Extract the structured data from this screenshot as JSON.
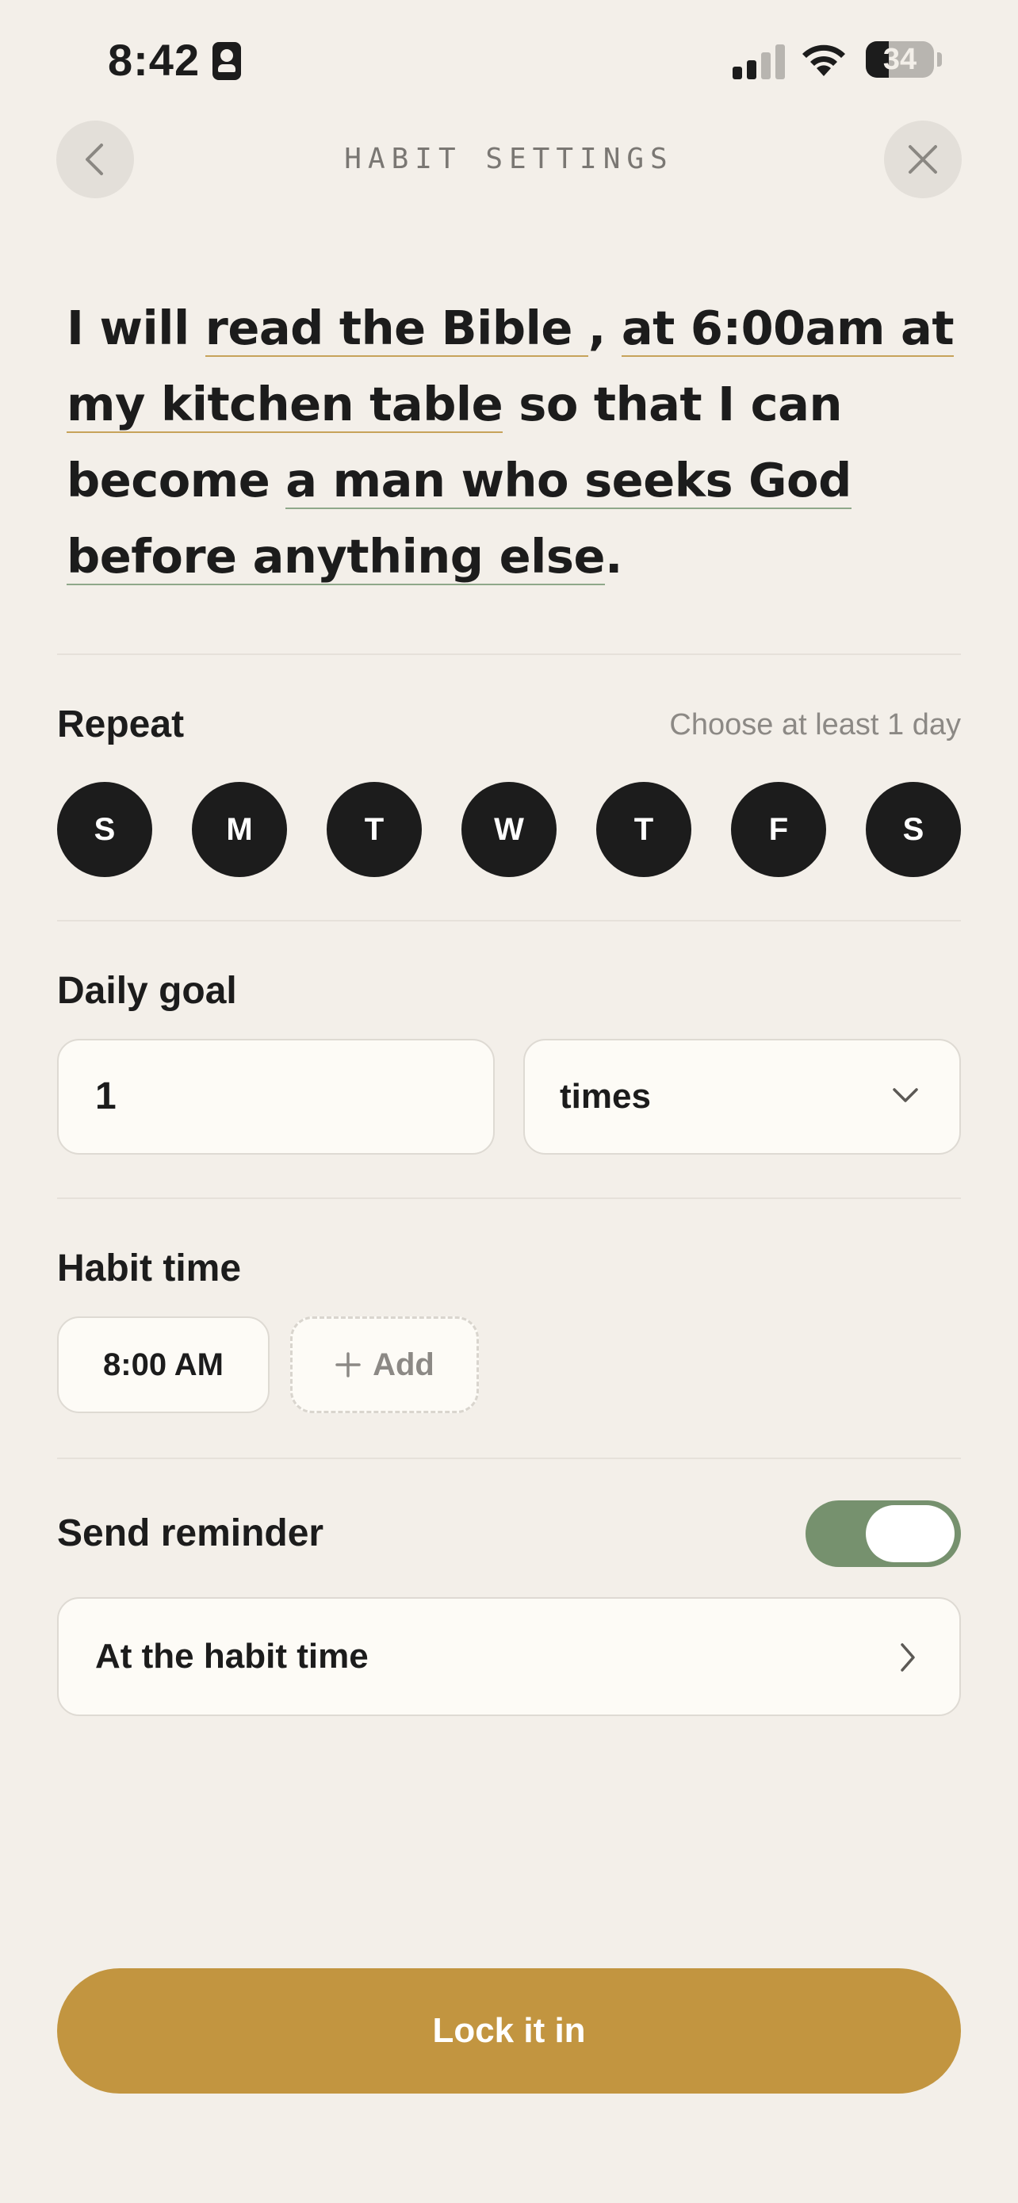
{
  "status_bar": {
    "time": "8:42",
    "battery": "34",
    "battery_level": 0.34,
    "icons": [
      "id-card-icon",
      "cellular-signal-icon",
      "wifi-icon",
      "battery-icon"
    ]
  },
  "header": {
    "title": "HABIT SETTINGS",
    "back_icon": "chevron-left-icon",
    "close_icon": "close-icon"
  },
  "statement": {
    "prefix": "I will ",
    "habit": "read the Bible ",
    "comma": ",",
    "space1": " ",
    "when_where": "at 6:00am at my kitchen table",
    "middle": " so that I can become ",
    "identity": "a man who seeks God before anything else",
    "end": ".",
    "accent_gold": "#c7a35a",
    "accent_green": "#8fa88a"
  },
  "repeat": {
    "label": "Repeat",
    "hint": "Choose at least 1 day",
    "days": [
      "S",
      "M",
      "T",
      "W",
      "T",
      "F",
      "S"
    ]
  },
  "daily_goal": {
    "label": "Daily goal",
    "value": "1",
    "unit": "times",
    "unit_icon": "chevron-down-icon"
  },
  "habit_time": {
    "label": "Habit time",
    "times": [
      "8:00 AM"
    ],
    "add_label": "Add",
    "add_icon": "plus-icon"
  },
  "reminder": {
    "label": "Send reminder",
    "enabled": true,
    "option": "At the habit time",
    "option_icon": "chevron-right-icon"
  },
  "cta": {
    "label": "Lock it in"
  },
  "colors": {
    "background": "#f3efe9",
    "primary_button": "#c29540",
    "toggle_on": "#76916e",
    "day_selected": "#1c1c1c"
  }
}
